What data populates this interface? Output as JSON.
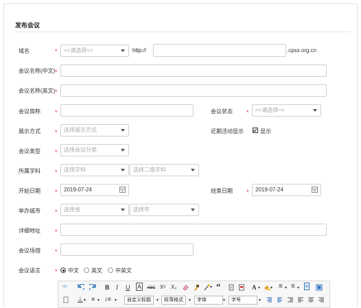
{
  "title": "发布会议",
  "domain": {
    "label": "域名",
    "select_placeholder": "==请选择==",
    "prefix": "http://",
    "suffix": ".cpss.org.cn"
  },
  "name_cn": {
    "label": "会议名称(中文)"
  },
  "name_en": {
    "label": "会议名称(英文)"
  },
  "abbr": {
    "label": "会议简称"
  },
  "status": {
    "label": "会议状态",
    "select_placeholder": "==请选择=="
  },
  "display_mode": {
    "label": "展示方式",
    "select_placeholder": "选择展示方式"
  },
  "recent": {
    "label": "近期活动显示",
    "checkbox_label": "显示",
    "checked": true
  },
  "type": {
    "label": "会议类型",
    "select_placeholder": "选择会议分类"
  },
  "discipline": {
    "label": "所属学科",
    "select1_placeholder": "选择学科",
    "select2_placeholder": "选择二级学科"
  },
  "start_date": {
    "label": "开始日期",
    "value": "2019-07-24"
  },
  "end_date": {
    "label": "结束日期",
    "value": "2019-07-24"
  },
  "city": {
    "label": "举办城市",
    "province_placeholder": "选择省",
    "city_placeholder": "选择市"
  },
  "address": {
    "label": "详细地址"
  },
  "venue": {
    "label": "会议场馆"
  },
  "language": {
    "label": "会议语言",
    "options": [
      "中文",
      "英文",
      "中英文"
    ],
    "selected": "中文"
  },
  "required_mark": "*",
  "editor": {
    "row1": [
      "B",
      "I",
      "U",
      "A",
      "ABC",
      "X²",
      "X₂",
      "“",
      "A",
      "≡",
      "≡",
      "a"
    ],
    "row2_selects": [
      "自定义标题",
      "段落格式",
      "字体",
      "字号"
    ]
  },
  "colors": {
    "required": "#e03a3a",
    "border": "#cfcfcf"
  }
}
